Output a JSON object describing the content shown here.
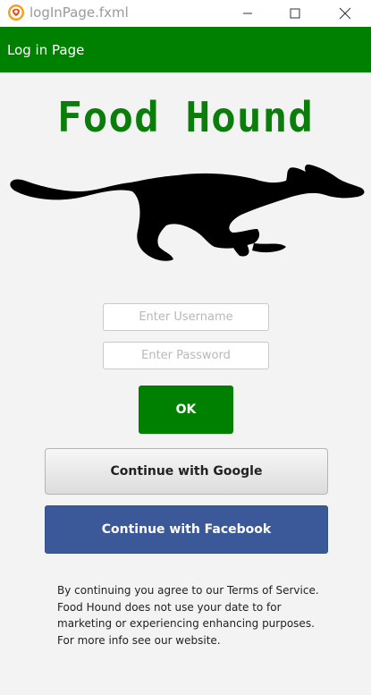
{
  "window": {
    "title": "logInPage.fxml",
    "icons": {
      "app": "app-logo-icon",
      "minimize": "minimize-icon",
      "maximize": "maximize-icon",
      "close": "close-icon"
    }
  },
  "header": {
    "title": "Log in Page"
  },
  "logo": {
    "text": "Food Hound",
    "image": "running-dog-silhouette-icon"
  },
  "form": {
    "username_placeholder": "Enter Username",
    "password_placeholder": "Enter Password",
    "ok_label": "OK"
  },
  "social": {
    "google_label": "Continue with Google",
    "facebook_label": "Continue with Facebook"
  },
  "terms": {
    "text": "By continuing you agree to our Terms of Service. Food Hound does not use your date to for marketing or experiencing enhancing purposes. For more info see our website."
  },
  "colors": {
    "header": "#008000",
    "ok_button": "#008000",
    "facebook": "#3b5998",
    "logo_text": "#0a7d0a"
  }
}
